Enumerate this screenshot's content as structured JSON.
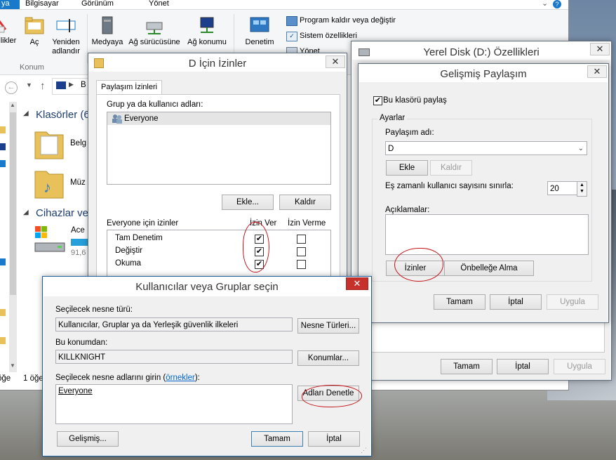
{
  "explorer": {
    "tabs": [
      "ya",
      "Bilgisayar",
      "Görünüm",
      "Yönet"
    ],
    "ribbon_buttons": [
      "likler",
      "Aç",
      "Yeniden adlandır",
      "Medyaya",
      "Ağ sürücüsüne",
      "Ağ konumu",
      "Denetim"
    ],
    "ribbon_small": [
      "Program kaldır veya değiştir",
      "Sistem özellikleri",
      "Yönet"
    ],
    "group_label": "Konum",
    "address_text": "B",
    "section_folders": "Klasörler (6",
    "section_devices": "Cihazlar ve",
    "folder_items": [
      "Belg",
      "Müz"
    ],
    "drive_name": "Ace",
    "drive_size": "91,6",
    "drive_fill_percent": 100,
    "status_left": "öğe",
    "status_count": "1 öğe"
  },
  "perm_dialog": {
    "title": "D İçin İzinler",
    "tab": "Paylaşım İzinleri",
    "group_label": "Grup ya da kullanıcı adları:",
    "users": [
      "Everyone"
    ],
    "add_label": "Ekle...",
    "remove_label": "Kaldır",
    "perms_for_label": "Everyone için izinler",
    "allow_header": "İzin Ver",
    "deny_header": "İzin Verme",
    "perms": [
      {
        "name": "Tam Denetim",
        "allow": true,
        "deny": false
      },
      {
        "name": "Değiştir",
        "allow": true,
        "deny": false
      },
      {
        "name": "Okuma",
        "allow": true,
        "deny": false
      }
    ]
  },
  "props_dialog": {
    "title": "Yerel Disk (D:) Özellikleri",
    "ok": "Tamam",
    "cancel": "İptal",
    "apply": "Uygula"
  },
  "share_dialog": {
    "title": "Gelişmiş Paylaşım",
    "share_checkbox": "Bu klasörü paylaş",
    "settings_label": "Ayarlar",
    "share_name_label": "Paylaşım adı:",
    "share_name_value": "D",
    "add_label": "Ekle",
    "remove_label": "Kaldır",
    "limit_label": "Eş zamanlı kullanıcı sayısını sınırla:",
    "limit_value": "20",
    "comments_label": "Açıklamalar:",
    "permissions_label": "İzinler",
    "caching_label": "Önbelleğe Alma",
    "ok": "Tamam",
    "cancel": "İptal",
    "apply": "Uygula"
  },
  "select_dialog": {
    "title": "Kullanıcılar veya Gruplar seçin",
    "object_type_label": "Seçilecek nesne türü:",
    "object_type_value": "Kullanıcılar, Gruplar ya da Yerleşik güvenlik ilkeleri",
    "object_types_button": "Nesne Türleri...",
    "location_label": "Bu konumdan:",
    "location_value": "KILLKNIGHT",
    "locations_button": "Konumlar...",
    "enter_names_label": "Seçilecek nesne adlarını girin (",
    "examples_link": "örnekler",
    "enter_names_suffix": "):",
    "names_value": "Everyone",
    "check_names_button": "Adları Denetle",
    "advanced_button": "Gelişmiş...",
    "ok": "Tamam",
    "cancel": "İptal"
  },
  "colors": {
    "accent": "#3c7fb1",
    "close_red": "#c7312b",
    "annotation_red": "#c4141a"
  }
}
